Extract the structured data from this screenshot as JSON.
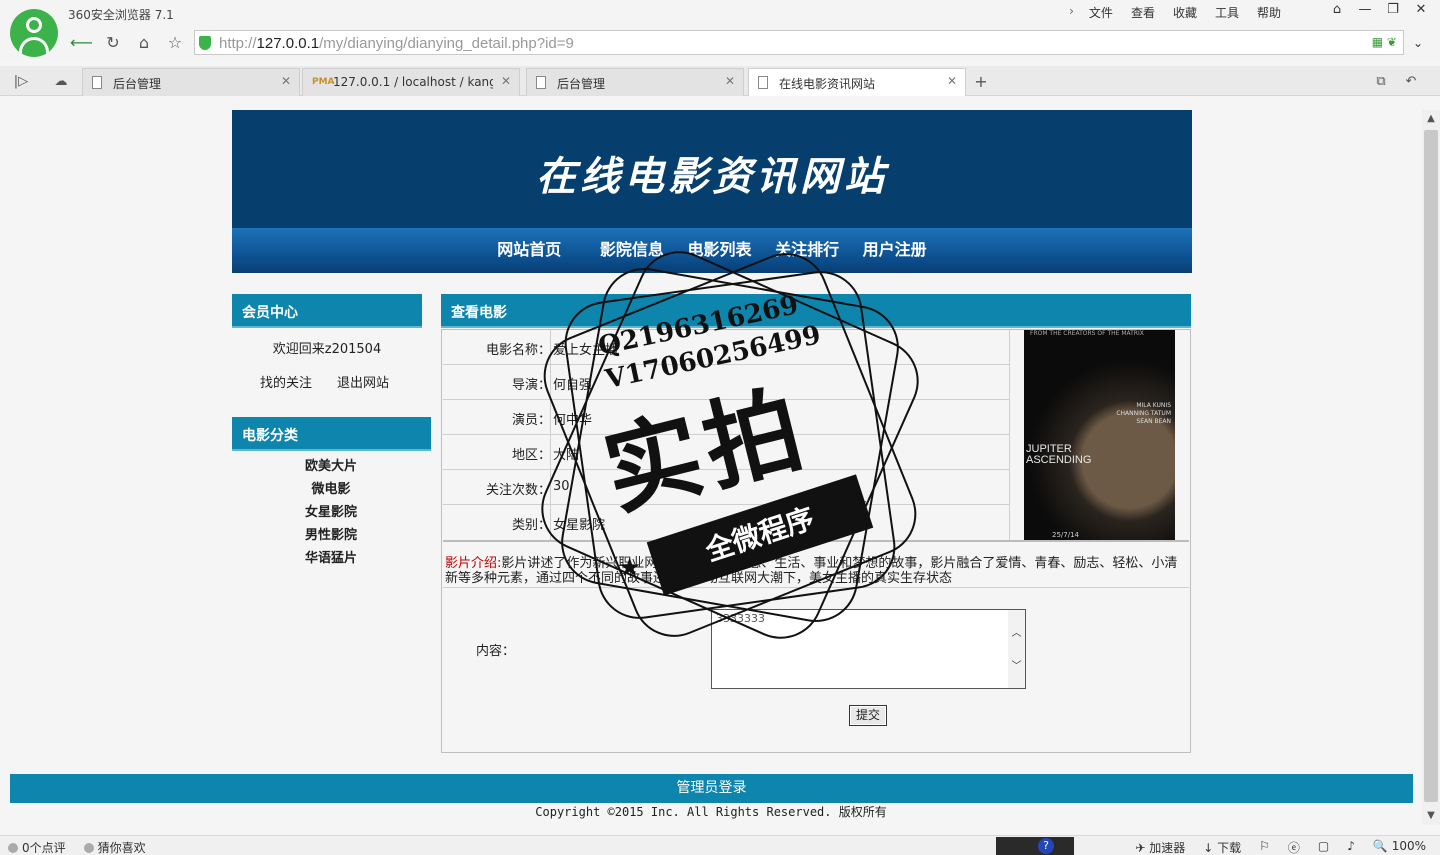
{
  "browser": {
    "app_title": "360安全浏览器 7.1",
    "menu": [
      "文件",
      "查看",
      "收藏",
      "工具",
      "帮助"
    ],
    "url_prefix": "http://",
    "url_host": "127.0.0.1",
    "url_path": "/my/dianying/dianying_detail.php?id=9",
    "tabs": [
      {
        "label": "后台管理",
        "active": false
      },
      {
        "label": "127.0.0.1 / localhost / kang_",
        "active": false
      },
      {
        "label": "后台管理",
        "active": false
      },
      {
        "label": "在线电影资讯网站",
        "active": true
      }
    ],
    "status_left": [
      "0个点评",
      "猜你喜欢"
    ],
    "status_right": [
      "加速器",
      "下载",
      "100%"
    ]
  },
  "site": {
    "title": "在线电影资讯网站",
    "nav": [
      "网站首页",
      "影院信息",
      "电影列表",
      "关注排行",
      "用户注册"
    ]
  },
  "sidebar": {
    "member_title": "会员中心",
    "welcome": "欢迎回来z201504",
    "my_follow": "找的关注",
    "logout": "退出网站",
    "category_title": "电影分类",
    "categories": [
      "欧美大片",
      "微电影",
      "女星影院",
      "男性影院",
      "华语猛片"
    ]
  },
  "detail": {
    "title": "查看电影",
    "rows": [
      {
        "label": "电影名称：",
        "value": "爱上女主播"
      },
      {
        "label": "导演：",
        "value": "何自强"
      },
      {
        "label": "演员：",
        "value": "何中华"
      },
      {
        "label": "地区：",
        "value": "大陆"
      },
      {
        "label": "关注次数：",
        "value": "30"
      },
      {
        "label": "类别：",
        "value": "女星影院"
      }
    ],
    "poster": {
      "top_text": "FROM THE CREATORS OF THE MATRIX",
      "cast": "MILA KUNIS\nCHANNING TATUM\nSEAN BEAN",
      "title_line1": "JUPITER",
      "title_line2": "ASCENDING",
      "date": "25/7/14"
    },
    "intro_label": "影片介绍:",
    "intro_text": "影片讲述了作为新兴职业网络主播们有关情感、生活、事业和梦想的故事，影片融合了爱情、青春、励志、轻松、小清新等多种元素，通过四个不同的故事还原了移动互联网大潮下，美女主播的真实生存状态",
    "content_label": "内容：",
    "content_value": "3333333",
    "submit": "提交"
  },
  "footer": {
    "admin_login": "管理员登录",
    "copyright": "Copyright ©2015 Inc. All Rights Reserved. 版权所有"
  },
  "watermark": {
    "qq": "Q2196316269",
    "v": "V17060256499",
    "big": "实拍",
    "ribbon": "全微程序"
  }
}
